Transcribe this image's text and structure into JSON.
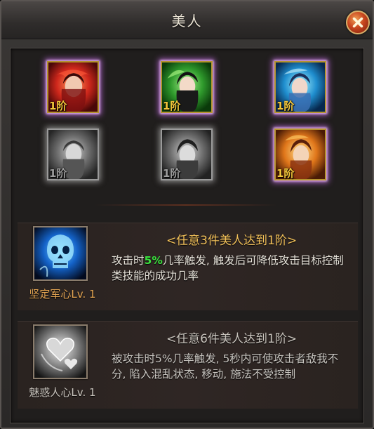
{
  "window": {
    "title": "美人"
  },
  "portraits": [
    {
      "rank": "1阶",
      "state": "active",
      "theme": "red"
    },
    {
      "rank": "1阶",
      "state": "active",
      "theme": "green"
    },
    {
      "rank": "1阶",
      "state": "active",
      "theme": "blue"
    },
    {
      "rank": "1阶",
      "state": "locked",
      "theme": "gray"
    },
    {
      "rank": "1阶",
      "state": "locked",
      "theme": "gray"
    },
    {
      "rank": "1阶",
      "state": "active",
      "theme": "orange"
    }
  ],
  "skills": [
    {
      "icon": "skull-ghost-icon",
      "name": "坚定军心Lv. 1",
      "condition": "<任意3件美人达到1阶>",
      "desc_before": "攻击时",
      "desc_highlight": "5%",
      "desc_after": "几率触发, 触发后可降低攻击目标控制类技能的成功几率",
      "active": true
    },
    {
      "icon": "hearts-icon",
      "name": "魅惑人心Lv. 1",
      "condition": "<任意6件美人达到1阶>",
      "desc": "被攻击时5%几率触发, 5秒内可使攻击者敌我不分, 陷入混乱状态, 移动, 施法不受控制",
      "active": false
    }
  ],
  "colors": {
    "highlight": "#39e23d",
    "condition_active": "#f2c15a",
    "name_active": "#e3a452"
  }
}
